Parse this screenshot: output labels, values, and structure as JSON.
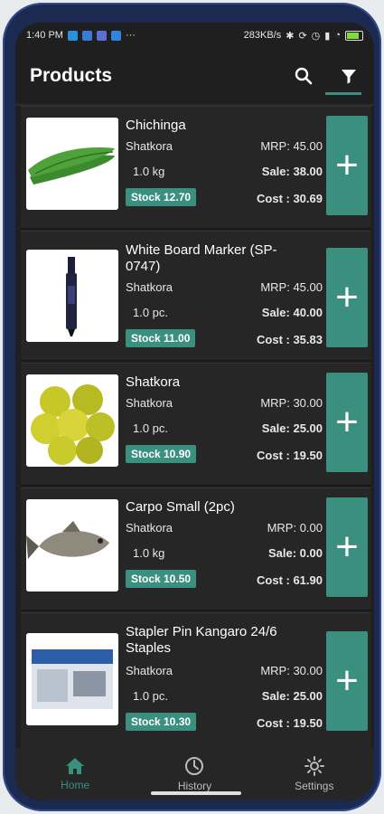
{
  "status": {
    "time": "1:40 PM",
    "net_speed": "283KB/s",
    "dots": "···"
  },
  "appbar": {
    "title": "Products"
  },
  "products": [
    {
      "name": "Chichinga",
      "location": "Shatkora",
      "qty": "1.0 kg",
      "mrp": "MRP: 45.00",
      "sale": "Sale: 38.00",
      "stock": "Stock 12.70",
      "cost": "Cost : 30.69"
    },
    {
      "name": "White Board Marker (SP-0747)",
      "location": "Shatkora",
      "qty": "1.0 pc.",
      "mrp": "MRP: 45.00",
      "sale": "Sale: 40.00",
      "stock": "Stock 11.00",
      "cost": "Cost : 35.83"
    },
    {
      "name": "Shatkora",
      "location": "Shatkora",
      "qty": "1.0 pc.",
      "mrp": "MRP: 30.00",
      "sale": "Sale: 25.00",
      "stock": "Stock 10.90",
      "cost": "Cost : 19.50"
    },
    {
      "name": "Carpo Small (2pc)",
      "location": "Shatkora",
      "qty": "1.0 kg",
      "mrp": "MRP: 0.00",
      "sale": "Sale: 0.00",
      "stock": "Stock 10.50",
      "cost": "Cost : 61.90"
    },
    {
      "name": "Stapler Pin Kangaro 24/6 Staples",
      "location": "Shatkora",
      "qty": "1.0 pc.",
      "mrp": "MRP: 30.00",
      "sale": "Sale: 25.00",
      "stock": "Stock 10.30",
      "cost": "Cost : 19.50"
    }
  ],
  "add_label": "+",
  "nav": {
    "home": "Home",
    "history": "History",
    "settings": "Settings"
  }
}
